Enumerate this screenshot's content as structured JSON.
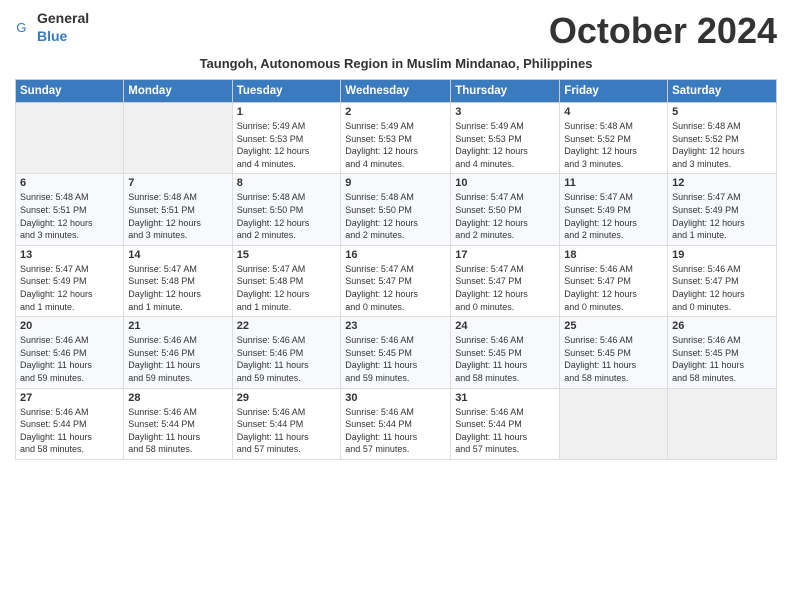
{
  "logo": {
    "general": "General",
    "blue": "Blue"
  },
  "title": "October 2024",
  "subtitle": "Taungoh, Autonomous Region in Muslim Mindanao, Philippines",
  "days_header": [
    "Sunday",
    "Monday",
    "Tuesday",
    "Wednesday",
    "Thursday",
    "Friday",
    "Saturday"
  ],
  "weeks": [
    [
      {
        "day": "",
        "info": ""
      },
      {
        "day": "",
        "info": ""
      },
      {
        "day": "1",
        "info": "Sunrise: 5:49 AM\nSunset: 5:53 PM\nDaylight: 12 hours\nand 4 minutes."
      },
      {
        "day": "2",
        "info": "Sunrise: 5:49 AM\nSunset: 5:53 PM\nDaylight: 12 hours\nand 4 minutes."
      },
      {
        "day": "3",
        "info": "Sunrise: 5:49 AM\nSunset: 5:53 PM\nDaylight: 12 hours\nand 4 minutes."
      },
      {
        "day": "4",
        "info": "Sunrise: 5:48 AM\nSunset: 5:52 PM\nDaylight: 12 hours\nand 3 minutes."
      },
      {
        "day": "5",
        "info": "Sunrise: 5:48 AM\nSunset: 5:52 PM\nDaylight: 12 hours\nand 3 minutes."
      }
    ],
    [
      {
        "day": "6",
        "info": "Sunrise: 5:48 AM\nSunset: 5:51 PM\nDaylight: 12 hours\nand 3 minutes."
      },
      {
        "day": "7",
        "info": "Sunrise: 5:48 AM\nSunset: 5:51 PM\nDaylight: 12 hours\nand 3 minutes."
      },
      {
        "day": "8",
        "info": "Sunrise: 5:48 AM\nSunset: 5:50 PM\nDaylight: 12 hours\nand 2 minutes."
      },
      {
        "day": "9",
        "info": "Sunrise: 5:48 AM\nSunset: 5:50 PM\nDaylight: 12 hours\nand 2 minutes."
      },
      {
        "day": "10",
        "info": "Sunrise: 5:47 AM\nSunset: 5:50 PM\nDaylight: 12 hours\nand 2 minutes."
      },
      {
        "day": "11",
        "info": "Sunrise: 5:47 AM\nSunset: 5:49 PM\nDaylight: 12 hours\nand 2 minutes."
      },
      {
        "day": "12",
        "info": "Sunrise: 5:47 AM\nSunset: 5:49 PM\nDaylight: 12 hours\nand 1 minute."
      }
    ],
    [
      {
        "day": "13",
        "info": "Sunrise: 5:47 AM\nSunset: 5:49 PM\nDaylight: 12 hours\nand 1 minute."
      },
      {
        "day": "14",
        "info": "Sunrise: 5:47 AM\nSunset: 5:48 PM\nDaylight: 12 hours\nand 1 minute."
      },
      {
        "day": "15",
        "info": "Sunrise: 5:47 AM\nSunset: 5:48 PM\nDaylight: 12 hours\nand 1 minute."
      },
      {
        "day": "16",
        "info": "Sunrise: 5:47 AM\nSunset: 5:47 PM\nDaylight: 12 hours\nand 0 minutes."
      },
      {
        "day": "17",
        "info": "Sunrise: 5:47 AM\nSunset: 5:47 PM\nDaylight: 12 hours\nand 0 minutes."
      },
      {
        "day": "18",
        "info": "Sunrise: 5:46 AM\nSunset: 5:47 PM\nDaylight: 12 hours\nand 0 minutes."
      },
      {
        "day": "19",
        "info": "Sunrise: 5:46 AM\nSunset: 5:47 PM\nDaylight: 12 hours\nand 0 minutes."
      }
    ],
    [
      {
        "day": "20",
        "info": "Sunrise: 5:46 AM\nSunset: 5:46 PM\nDaylight: 11 hours\nand 59 minutes."
      },
      {
        "day": "21",
        "info": "Sunrise: 5:46 AM\nSunset: 5:46 PM\nDaylight: 11 hours\nand 59 minutes."
      },
      {
        "day": "22",
        "info": "Sunrise: 5:46 AM\nSunset: 5:46 PM\nDaylight: 11 hours\nand 59 minutes."
      },
      {
        "day": "23",
        "info": "Sunrise: 5:46 AM\nSunset: 5:45 PM\nDaylight: 11 hours\nand 59 minutes."
      },
      {
        "day": "24",
        "info": "Sunrise: 5:46 AM\nSunset: 5:45 PM\nDaylight: 11 hours\nand 58 minutes."
      },
      {
        "day": "25",
        "info": "Sunrise: 5:46 AM\nSunset: 5:45 PM\nDaylight: 11 hours\nand 58 minutes."
      },
      {
        "day": "26",
        "info": "Sunrise: 5:46 AM\nSunset: 5:45 PM\nDaylight: 11 hours\nand 58 minutes."
      }
    ],
    [
      {
        "day": "27",
        "info": "Sunrise: 5:46 AM\nSunset: 5:44 PM\nDaylight: 11 hours\nand 58 minutes."
      },
      {
        "day": "28",
        "info": "Sunrise: 5:46 AM\nSunset: 5:44 PM\nDaylight: 11 hours\nand 58 minutes."
      },
      {
        "day": "29",
        "info": "Sunrise: 5:46 AM\nSunset: 5:44 PM\nDaylight: 11 hours\nand 57 minutes."
      },
      {
        "day": "30",
        "info": "Sunrise: 5:46 AM\nSunset: 5:44 PM\nDaylight: 11 hours\nand 57 minutes."
      },
      {
        "day": "31",
        "info": "Sunrise: 5:46 AM\nSunset: 5:44 PM\nDaylight: 11 hours\nand 57 minutes."
      },
      {
        "day": "",
        "info": ""
      },
      {
        "day": "",
        "info": ""
      }
    ]
  ]
}
